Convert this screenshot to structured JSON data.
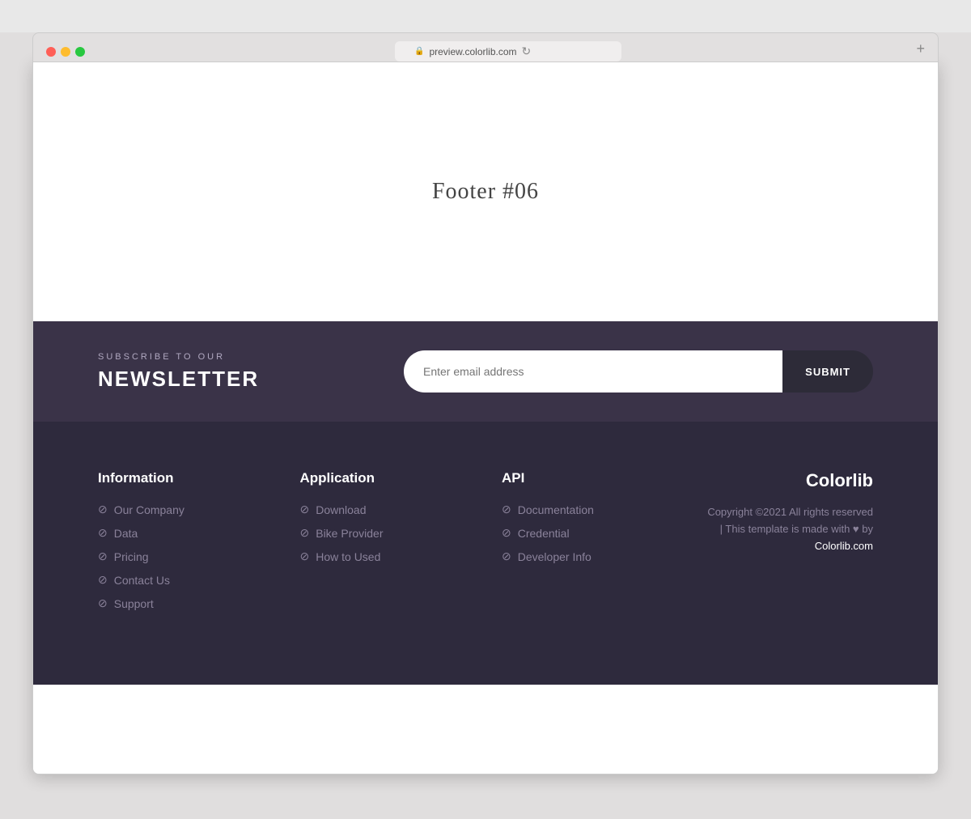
{
  "browser": {
    "url": "preview.colorlib.com",
    "new_tab_icon": "+"
  },
  "main": {
    "page_title": "Footer #06"
  },
  "newsletter": {
    "subtitle": "SUBSCRIBE TO OUR",
    "title": "NEWSLETTER",
    "email_placeholder": "Enter email address",
    "submit_label": "SUBMIT"
  },
  "footer": {
    "columns": [
      {
        "title": "Information",
        "links": [
          "Our Company",
          "Data",
          "Pricing",
          "Contact Us",
          "Support"
        ]
      },
      {
        "title": "Application",
        "links": [
          "Download",
          "Bike Provider",
          "How to Used"
        ]
      },
      {
        "title": "API",
        "links": [
          "Documentation",
          "Credential",
          "Developer Info"
        ]
      }
    ],
    "brand": {
      "name": "Colorlib",
      "copyright": "Copyright ©2021 All rights reserved | This template is made with ♥ by",
      "copyright_link": "Colorlib.com"
    }
  }
}
